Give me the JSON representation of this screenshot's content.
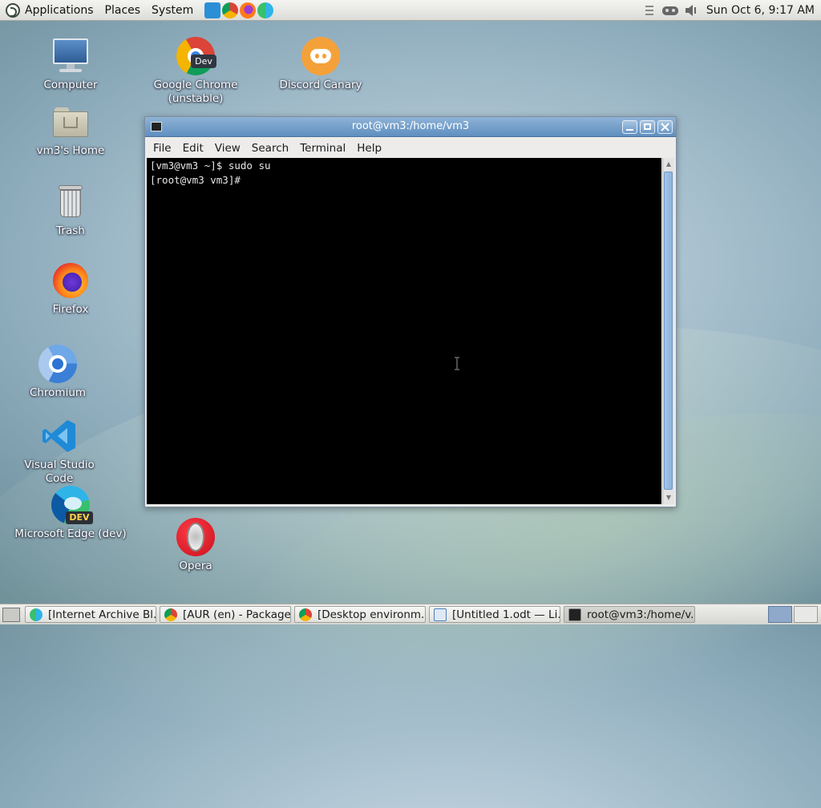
{
  "top_panel": {
    "menus": [
      "Applications",
      "Places",
      "System"
    ],
    "clock": "Sun Oct  6,  9:17 AM"
  },
  "desktop_icons": [
    {
      "label": "Computer"
    },
    {
      "label": "Google Chrome (unstable)",
      "badge": "Dev"
    },
    {
      "label": "Discord Canary"
    },
    {
      "label": "vm3's Home"
    },
    {
      "label": "Trash"
    },
    {
      "label": "Firefox"
    },
    {
      "label": "Chromium"
    },
    {
      "label": "Visual Studio Code"
    },
    {
      "label": "Microsoft Edge (dev)",
      "badge": "DEV"
    },
    {
      "label": "Opera"
    }
  ],
  "terminal": {
    "title": "root@vm3:/home/vm3",
    "menu": [
      "File",
      "Edit",
      "View",
      "Search",
      "Terminal",
      "Help"
    ],
    "lines": [
      "[vm3@vm3 ~]$ sudo su",
      "[root@vm3 vm3]#"
    ]
  },
  "taskbar": [
    {
      "label": "[Internet Archive Bl...",
      "icon": "edge-icon"
    },
    {
      "label": "[AUR (en) - Package...",
      "icon": "chrome-icon"
    },
    {
      "label": "[Desktop environm...",
      "icon": "chrome-icon"
    },
    {
      "label": "[Untitled 1.odt — Li...",
      "icon": "writer-icon"
    },
    {
      "label": "root@vm3:/home/v...",
      "icon": "terminal-icon"
    }
  ],
  "colors": {
    "titlebar": "#6f9bc9",
    "terminal_bg": "#000000",
    "accent": "#5f8fc0"
  }
}
